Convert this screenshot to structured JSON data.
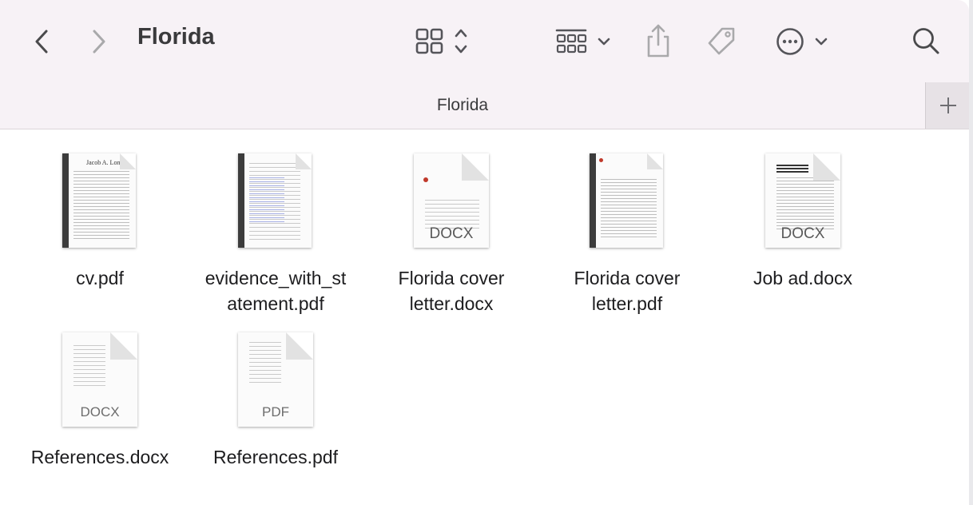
{
  "window": {
    "title": "Florida",
    "tab_label": "Florida"
  },
  "toolbar": {
    "back_icon": "chevron-left-icon",
    "forward_icon": "chevron-right-icon",
    "view_icon": "icon-grid-icon",
    "group_icon": "group-grid-icon",
    "share_icon": "share-icon",
    "tag_icon": "tag-icon",
    "more_icon": "ellipsis-circle-icon",
    "search_icon": "search-icon",
    "add_tab_icon": "plus-icon"
  },
  "files": [
    {
      "name": "cv.pdf",
      "type_label": ""
    },
    {
      "name": "evidence_with_statement.pdf",
      "type_label": ""
    },
    {
      "name": "Florida cover letter.docx",
      "type_label": "DOCX"
    },
    {
      "name": "Florida cover letter.pdf",
      "type_label": ""
    },
    {
      "name": "Job ad.docx",
      "type_label": "DOCX"
    },
    {
      "name": "References.docx",
      "type_label": "DOCX"
    },
    {
      "name": "References.pdf",
      "type_label": "PDF"
    }
  ],
  "thumb_text": {
    "cv_header": "Jacob A. Long"
  }
}
